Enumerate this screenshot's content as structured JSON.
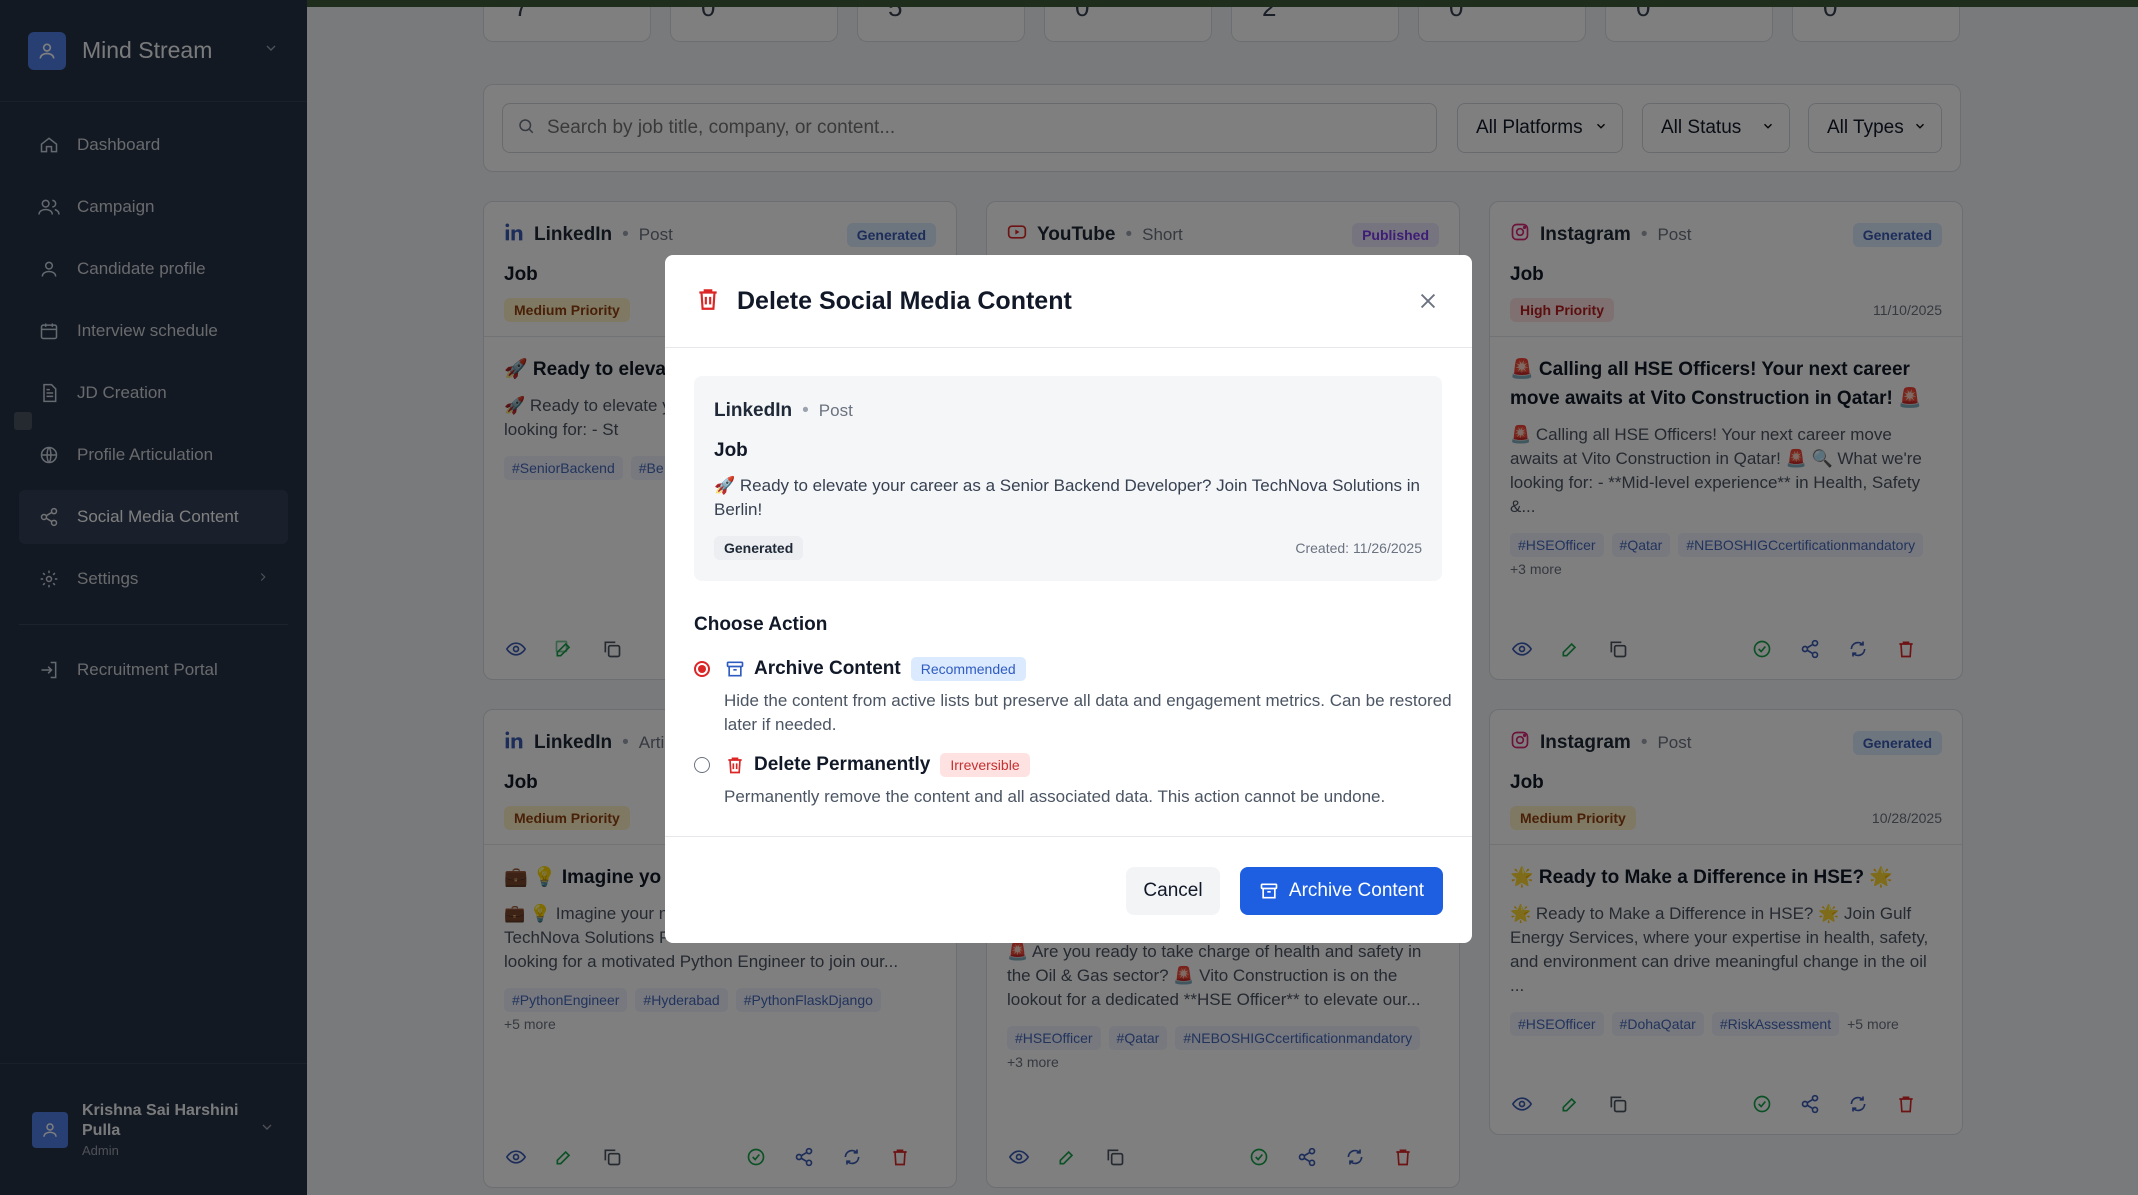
{
  "sidebar": {
    "brand": "Mind Stream",
    "items": [
      {
        "label": "Dashboard",
        "icon": "home-icon"
      },
      {
        "label": "Campaign",
        "icon": "users-icon"
      },
      {
        "label": "Candidate profile",
        "icon": "user-icon"
      },
      {
        "label": "Interview schedule",
        "icon": "calendar-icon"
      },
      {
        "label": "JD Creation",
        "icon": "document-icon"
      },
      {
        "label": "Profile Articulation",
        "icon": "globe-icon"
      },
      {
        "label": "Social Media Content",
        "icon": "share-icon",
        "active": true
      },
      {
        "label": "Settings",
        "icon": "gear-icon"
      }
    ],
    "portal": "Recruitment Portal",
    "user": {
      "name": "Krishna Sai Harshini Pulla",
      "role": "Admin"
    }
  },
  "stats": [
    "7",
    "0",
    "5",
    "0",
    "2",
    "0",
    "0",
    "0"
  ],
  "filters": {
    "search_placeholder": "Search by job title, company, or content...",
    "platform": "All Platforms",
    "status": "All Status",
    "type": "All Types"
  },
  "cards": [
    {
      "platform": "LinkedIn",
      "type": "Post",
      "status": "Generated",
      "title": "Job",
      "priority": "Medium Priority",
      "headline": "🚀 Ready to elevat Backend Develope",
      "body": "🚀 Ready to elevate y Developer? Join TechN we're looking for: - St",
      "tags": [
        "#SeniorBackend",
        "#Be"
      ]
    },
    {
      "platform": "YouTube",
      "type": "Short",
      "status": "Published"
    },
    {
      "platform": "Instagram",
      "type": "Post",
      "status": "Generated",
      "title": "Job",
      "priority": "High Priority",
      "date": "11/10/2025",
      "headline": "🚨 Calling all HSE Officers! Your next career move awaits at Vito Construction in Qatar! 🚨",
      "body": "🚨 Calling all HSE Officers! Your next career move awaits at Vito Construction in Qatar! 🚨 🔍 What we're looking for: - **Mid-level experience** in Health, Safety &...",
      "tags": [
        "#HSEOfficer",
        "#Qatar",
        "#NEBOSHIGCcertificationmandatory"
      ],
      "more": "+3 more"
    },
    {
      "platform": "LinkedIn",
      "type": "Artic",
      "title": "Job",
      "priority": "Medium Priority",
      "headline": "💼 💡 Imagine yo at TechNova Soluti",
      "body": "💼 💡 Imagine your next role: Python Engineer at TechNova Solutions Pvt. Ltd. TechNova Solutions is looking for a motivated Python Engineer to join our...",
      "tags": [
        "#PythonEngineer",
        "#Hyderabad",
        "#PythonFlaskDjango"
      ],
      "more": "+5 more"
    },
    {
      "body": "🚨 Are you ready to take charge of health and safety in the Oil & Gas sector? 🚨 Vito Construction is on the lookout for a dedicated **HSE Officer** to elevate our...",
      "tags": [
        "#HSEOfficer",
        "#Qatar",
        "#NEBOSHIGCcertificationmandatory"
      ],
      "more": "+3 more"
    },
    {
      "platform": "Instagram",
      "type": "Post",
      "status": "Generated",
      "title": "Job",
      "priority": "Medium Priority",
      "date": "10/28/2025",
      "headline": "🌟 Ready to Make a Difference in HSE? 🌟",
      "body": "🌟 Ready to Make a Difference in HSE? 🌟 Join Gulf Energy Services, where your expertise in health, safety, and environment can drive meaningful change in the oil ...",
      "tags": [
        "#HSEOfficer",
        "#DohaQatar",
        "#RiskAssessment"
      ],
      "more": "+5 more"
    }
  ],
  "modal": {
    "title": "Delete Social Media Content",
    "preview": {
      "platform": "LinkedIn",
      "type": "Post",
      "title": "Job",
      "body": "🚀 Ready to elevate your career as a Senior Backend Developer? Join TechNova Solutions in Berlin!",
      "status": "Generated",
      "created": "Created: 11/26/2025"
    },
    "choose_label": "Choose Action",
    "options": [
      {
        "title": "Archive Content",
        "badge": "Recommended",
        "selected": true,
        "desc": "Hide the content from active lists but preserve all data and engagement metrics. Can be restored later if needed."
      },
      {
        "title": "Delete Permanently",
        "badge": "Irreversible",
        "selected": false,
        "desc": "Permanently remove the content and all associated data. This action cannot be undone."
      }
    ],
    "cancel": "Cancel",
    "confirm": "Archive Content"
  },
  "colors": {
    "sidebar": "#263245",
    "accent": "#1d5fe0",
    "danger": "#dc2626"
  }
}
